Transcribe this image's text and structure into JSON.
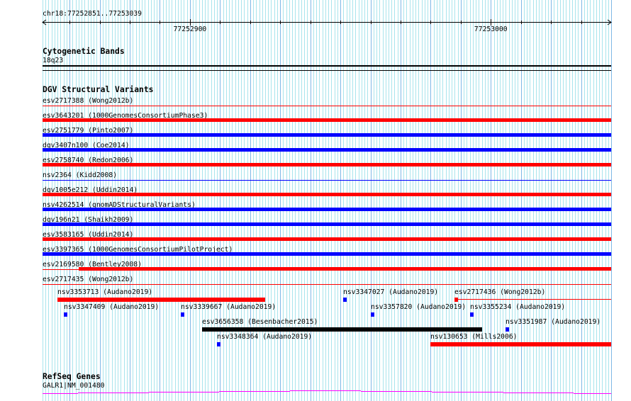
{
  "ruler": {
    "location": "chr18:77252851..77253039",
    "view_start": 77252851,
    "view_end": 77253040,
    "tick_labels": [
      {
        "pos": 77252900,
        "label": "77252900"
      },
      {
        "pos": 77253000,
        "label": "77253000"
      }
    ]
  },
  "colors": {
    "red": "#ff0000",
    "blue": "#0000ff",
    "black": "#000000",
    "gene": "#ff00ff",
    "grid_minor": "#a8e4ec",
    "grid_major": "#7fb8e6"
  },
  "cytoband": {
    "title": "Cytogenetic Bands",
    "band": "18q23"
  },
  "dgv": {
    "title": "DGV Structural Variants",
    "rows": [
      {
        "label": "esv2717388 (Wong2012b)",
        "color": "red",
        "style": "thin"
      },
      {
        "label": "esv3643201 (1000GenomesConsortiumPhase3)",
        "color": "red",
        "style": "thick"
      },
      {
        "label": "esv2751779 (Pinto2007)",
        "color": "blue",
        "style": "thick"
      },
      {
        "label": "dgv3407n100 (Coe2014)",
        "color": "blue",
        "style": "thick"
      },
      {
        "label": "esv2758740 (Redon2006)",
        "color": "red",
        "style": "thick"
      },
      {
        "label": "nsv2364 (Kidd2008)",
        "color": "blue",
        "style": "thin"
      },
      {
        "label": "dgv1005e212 (Uddin2014)",
        "color": "red",
        "style": "thick"
      },
      {
        "label": "nsv4262514 (gnomADStructuralVariants)",
        "color": "blue",
        "style": "thick"
      },
      {
        "label": "dgv196n21 (Shaikh2009)",
        "color": "blue",
        "style": "thick"
      },
      {
        "label": "esv3583165 (Uddin2014)",
        "color": "red",
        "style": "thick"
      },
      {
        "label": "esv3397365 (1000GenomesConsortiumPilotProject)",
        "color": "blue",
        "style": "thick"
      },
      {
        "label": "esv2169580 (Bentley2008)",
        "color": "red",
        "style": "thin-thick",
        "thick_start": 77252863
      },
      {
        "label": "esv2717435 (Wong2012b)",
        "color": "red",
        "style": "thin"
      }
    ],
    "packed": [
      {
        "row": 0,
        "label": "nsv3353713 (Audano2019)",
        "start": 77252856,
        "end": 77252925,
        "color": "red"
      },
      {
        "row": 0,
        "label": "nsv3347027 (Audano2019)",
        "start": 77252951,
        "end": 77252952,
        "color": "blue"
      },
      {
        "row": 0,
        "label": "esv2717436 (Wong2012b)",
        "start": 77252988,
        "end": 77252989,
        "color": "red",
        "thin_to": 77253040
      },
      {
        "row": 1,
        "label": "nsv3347409 (Audano2019)",
        "start": 77252858,
        "end": 77252859,
        "color": "blue"
      },
      {
        "row": 1,
        "label": "nsv3339667 (Audano2019)",
        "start": 77252897,
        "end": 77252898,
        "color": "blue"
      },
      {
        "row": 1,
        "label": "nsv3357820 (Audano2019)",
        "start": 77252960,
        "end": 77252961,
        "color": "blue"
      },
      {
        "row": 1,
        "label": "nsv3355234 (Audano2019)",
        "start": 77252993,
        "end": 77252994,
        "color": "blue"
      },
      {
        "row": 2,
        "label": "esv3656358 (Besenbacher2015)",
        "start": 77252904,
        "end": 77252997,
        "color": "black"
      },
      {
        "row": 2,
        "label": "nsv3351987 (Audano2019)",
        "start": 77253005,
        "end": 77253006,
        "color": "blue"
      },
      {
        "row": 3,
        "label": "nsv3348364 (Audano2019)",
        "start": 77252909,
        "end": 77252910,
        "color": "blue"
      },
      {
        "row": 3,
        "label": "nsv130653 (Mills2006)",
        "start": 77252980,
        "end": 77253040,
        "color": "red"
      }
    ]
  },
  "refseq": {
    "title": "RefSeq Genes",
    "gene": "GALR1|NM_001480"
  }
}
